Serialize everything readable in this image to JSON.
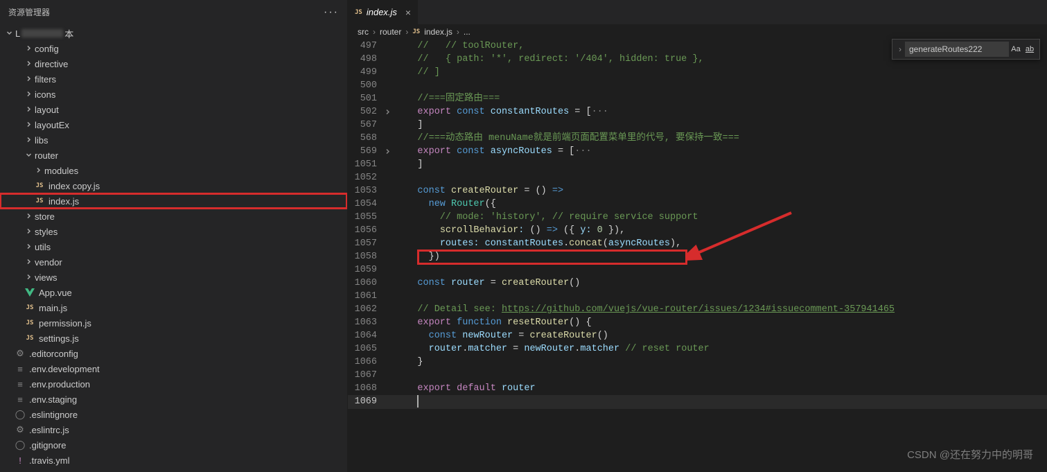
{
  "sidebar": {
    "title": "资源管理器",
    "root": {
      "label": "本"
    },
    "items": [
      {
        "type": "folder",
        "label": "config",
        "indent": 2,
        "open": false
      },
      {
        "type": "folder",
        "label": "directive",
        "indent": 2,
        "open": false
      },
      {
        "type": "folder",
        "label": "filters",
        "indent": 2,
        "open": false
      },
      {
        "type": "folder",
        "label": "icons",
        "indent": 2,
        "open": false
      },
      {
        "type": "folder",
        "label": "layout",
        "indent": 2,
        "open": false
      },
      {
        "type": "folder",
        "label": "layoutEx",
        "indent": 2,
        "open": false
      },
      {
        "type": "folder",
        "label": "libs",
        "indent": 2,
        "open": false
      },
      {
        "type": "folder",
        "label": "router",
        "indent": 2,
        "open": true
      },
      {
        "type": "folder",
        "label": "modules",
        "indent": 3,
        "open": false
      },
      {
        "type": "file",
        "icon": "js",
        "label": "index copy.js",
        "indent": 3
      },
      {
        "type": "file",
        "icon": "js",
        "label": "index.js",
        "indent": 3,
        "highlighted": true
      },
      {
        "type": "folder",
        "label": "store",
        "indent": 2,
        "open": false
      },
      {
        "type": "folder",
        "label": "styles",
        "indent": 2,
        "open": false
      },
      {
        "type": "folder",
        "label": "utils",
        "indent": 2,
        "open": false
      },
      {
        "type": "folder",
        "label": "vendor",
        "indent": 2,
        "open": false
      },
      {
        "type": "folder",
        "label": "views",
        "indent": 2,
        "open": false
      },
      {
        "type": "file",
        "icon": "vue",
        "label": "App.vue",
        "indent": 2
      },
      {
        "type": "file",
        "icon": "js",
        "label": "main.js",
        "indent": 2
      },
      {
        "type": "file",
        "icon": "js",
        "label": "permission.js",
        "indent": 2
      },
      {
        "type": "file",
        "icon": "js",
        "label": "settings.js",
        "indent": 2
      },
      {
        "type": "file",
        "icon": "gear",
        "label": ".editorconfig",
        "indent": 1
      },
      {
        "type": "file",
        "icon": "env",
        "label": ".env.development",
        "indent": 1
      },
      {
        "type": "file",
        "icon": "env",
        "label": ".env.production",
        "indent": 1
      },
      {
        "type": "file",
        "icon": "env",
        "label": ".env.staging",
        "indent": 1
      },
      {
        "type": "file",
        "icon": "git",
        "label": ".eslintignore",
        "indent": 1
      },
      {
        "type": "file",
        "icon": "gear",
        "label": ".eslintrc.js",
        "indent": 1
      },
      {
        "type": "file",
        "icon": "git",
        "label": ".gitignore",
        "indent": 1
      },
      {
        "type": "file",
        "icon": "excl",
        "label": ".travis.yml",
        "indent": 1
      }
    ]
  },
  "tab": {
    "icon": "JS",
    "label": "index.js"
  },
  "breadcrumb": [
    "src",
    "router",
    "index.js",
    "..."
  ],
  "search": {
    "value": "generateRoutes222",
    "options": [
      "Aa",
      "ab"
    ]
  },
  "code": [
    {
      "n": 497,
      "segs": [
        [
          "c-green",
          "    //   // toolRouter,"
        ]
      ]
    },
    {
      "n": 498,
      "segs": [
        [
          "c-green",
          "    //   { path: '*', redirect: '/404', hidden: true },"
        ]
      ]
    },
    {
      "n": 499,
      "segs": [
        [
          "c-green",
          "    // ]"
        ]
      ]
    },
    {
      "n": 500,
      "segs": [
        [
          "c-white",
          ""
        ]
      ]
    },
    {
      "n": 501,
      "segs": [
        [
          "c-green",
          "    //===固定路由==="
        ]
      ]
    },
    {
      "n": 502,
      "fold": true,
      "segs": [
        [
          "c-purple",
          "    export"
        ],
        [
          "c-white",
          " "
        ],
        [
          "c-blue",
          "const"
        ],
        [
          "c-white",
          " "
        ],
        [
          "c-lblue",
          "constantRoutes"
        ],
        [
          "c-white",
          " = ["
        ],
        [
          "c-gray",
          "···"
        ]
      ]
    },
    {
      "n": 567,
      "segs": [
        [
          "c-white",
          "    ]"
        ]
      ]
    },
    {
      "n": 568,
      "segs": [
        [
          "c-green",
          "    //===动态路由 menuName就是前端页面配置菜单里的代号, 要保持一致==="
        ]
      ]
    },
    {
      "n": 569,
      "fold": true,
      "segs": [
        [
          "c-purple",
          "    export"
        ],
        [
          "c-white",
          " "
        ],
        [
          "c-blue",
          "const"
        ],
        [
          "c-white",
          " "
        ],
        [
          "c-lblue",
          "asyncRoutes"
        ],
        [
          "c-white",
          " = ["
        ],
        [
          "c-gray",
          "···"
        ]
      ]
    },
    {
      "n": 1051,
      "segs": [
        [
          "c-white",
          "    ]"
        ]
      ]
    },
    {
      "n": 1052,
      "segs": [
        [
          "c-white",
          ""
        ]
      ]
    },
    {
      "n": 1053,
      "segs": [
        [
          "c-white",
          "    "
        ],
        [
          "c-blue",
          "const"
        ],
        [
          "c-white",
          " "
        ],
        [
          "c-yellow",
          "createRouter"
        ],
        [
          "c-white",
          " = () "
        ],
        [
          "c-blue",
          "=>"
        ],
        [
          "c-white",
          ""
        ]
      ]
    },
    {
      "n": 1054,
      "segs": [
        [
          "c-white",
          "      "
        ],
        [
          "c-blue",
          "new"
        ],
        [
          "c-white",
          " "
        ],
        [
          "c-cyan",
          "Router"
        ],
        [
          "c-white",
          "({"
        ]
      ]
    },
    {
      "n": 1055,
      "segs": [
        [
          "c-green",
          "        // mode: 'history', // require service support"
        ]
      ]
    },
    {
      "n": 1056,
      "segs": [
        [
          "c-white",
          "        "
        ],
        [
          "c-yellow",
          "scrollBehavior"
        ],
        [
          "c-lblue",
          ":"
        ],
        [
          "c-white",
          " () "
        ],
        [
          "c-blue",
          "=>"
        ],
        [
          "c-white",
          " ({ "
        ],
        [
          "c-lblue",
          "y:"
        ],
        [
          "c-white",
          " "
        ],
        [
          "c-num",
          "0"
        ],
        [
          "c-white",
          " }),"
        ]
      ]
    },
    {
      "n": 1057,
      "segs": [
        [
          "c-white",
          "        "
        ],
        [
          "c-lblue",
          "routes:"
        ],
        [
          "c-white",
          " "
        ],
        [
          "c-lblue",
          "constantRoutes"
        ],
        [
          "c-white",
          "."
        ],
        [
          "c-yellow",
          "concat"
        ],
        [
          "c-white",
          "("
        ],
        [
          "c-lblue",
          "asyncRoutes"
        ],
        [
          "c-white",
          "),"
        ]
      ]
    },
    {
      "n": 1058,
      "segs": [
        [
          "c-white",
          "      })"
        ]
      ]
    },
    {
      "n": 1059,
      "segs": [
        [
          "c-white",
          ""
        ]
      ]
    },
    {
      "n": 1060,
      "segs": [
        [
          "c-white",
          "    "
        ],
        [
          "c-blue",
          "const"
        ],
        [
          "c-white",
          " "
        ],
        [
          "c-lblue",
          "router"
        ],
        [
          "c-white",
          " = "
        ],
        [
          "c-yellow",
          "createRouter"
        ],
        [
          "c-white",
          "()"
        ]
      ]
    },
    {
      "n": 1061,
      "segs": [
        [
          "c-white",
          ""
        ]
      ]
    },
    {
      "n": 1062,
      "segs": [
        [
          "c-white",
          "    "
        ],
        [
          "c-green",
          "// Detail see: "
        ],
        [
          "c-link",
          "https://github.com/vuejs/vue-router/issues/1234#issuecomment-357941465"
        ]
      ]
    },
    {
      "n": 1063,
      "segs": [
        [
          "c-white",
          "    "
        ],
        [
          "c-purple",
          "export"
        ],
        [
          "c-white",
          " "
        ],
        [
          "c-blue",
          "function"
        ],
        [
          "c-white",
          " "
        ],
        [
          "c-yellow",
          "resetRouter"
        ],
        [
          "c-white",
          "() {"
        ]
      ]
    },
    {
      "n": 1064,
      "segs": [
        [
          "c-white",
          "      "
        ],
        [
          "c-blue",
          "const"
        ],
        [
          "c-white",
          " "
        ],
        [
          "c-lblue",
          "newRouter"
        ],
        [
          "c-white",
          " = "
        ],
        [
          "c-yellow",
          "createRouter"
        ],
        [
          "c-white",
          "()"
        ]
      ]
    },
    {
      "n": 1065,
      "segs": [
        [
          "c-white",
          "      "
        ],
        [
          "c-lblue",
          "router"
        ],
        [
          "c-white",
          "."
        ],
        [
          "c-lblue",
          "matcher"
        ],
        [
          "c-white",
          " = "
        ],
        [
          "c-lblue",
          "newRouter"
        ],
        [
          "c-white",
          "."
        ],
        [
          "c-lblue",
          "matcher"
        ],
        [
          "c-white",
          " "
        ],
        [
          "c-green",
          "// reset router"
        ]
      ]
    },
    {
      "n": 1066,
      "segs": [
        [
          "c-white",
          "    }"
        ]
      ]
    },
    {
      "n": 1067,
      "segs": [
        [
          "c-white",
          ""
        ]
      ]
    },
    {
      "n": 1068,
      "segs": [
        [
          "c-white",
          "    "
        ],
        [
          "c-purple",
          "export"
        ],
        [
          "c-white",
          " "
        ],
        [
          "c-purple",
          "default"
        ],
        [
          "c-white",
          " "
        ],
        [
          "c-lblue",
          "router"
        ]
      ]
    },
    {
      "n": 1069,
      "cursor": true,
      "segs": [
        [
          "c-white",
          "    "
        ]
      ]
    }
  ],
  "watermark": "CSDN @还在努力中的明哥"
}
